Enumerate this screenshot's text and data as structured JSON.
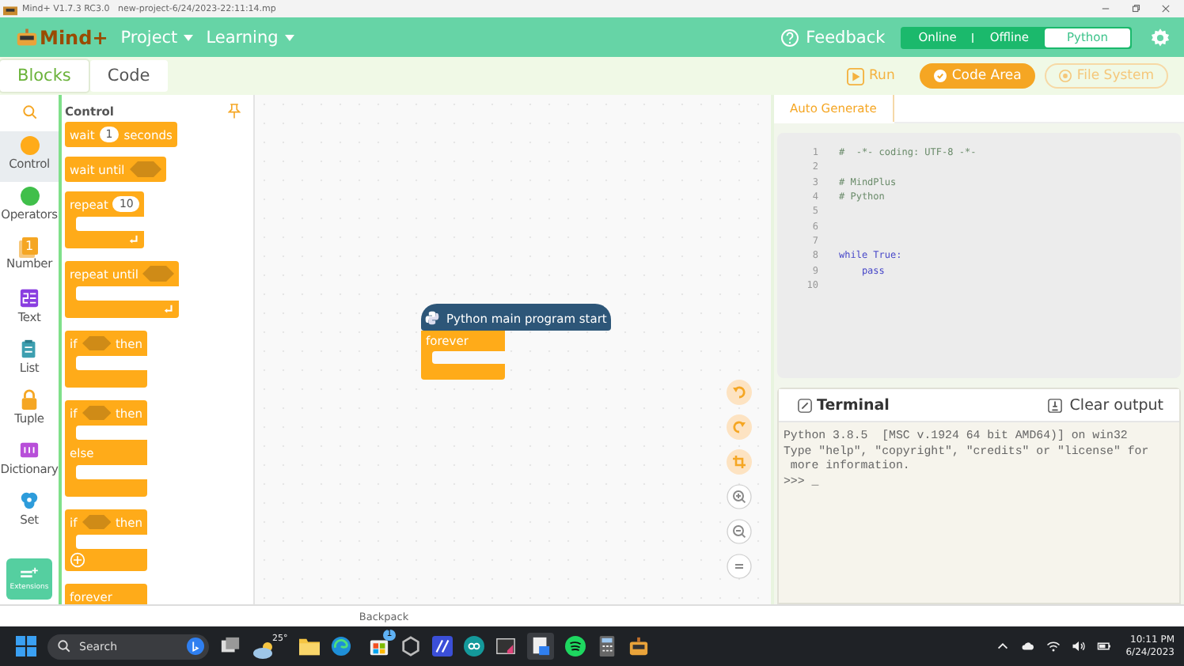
{
  "window": {
    "title": "Mind+ V1.7.3 RC3.0   new-project-6/24/2023-22:11:14.mp"
  },
  "header": {
    "logo": "Mind+",
    "menus": [
      {
        "label": "Project"
      },
      {
        "label": "Learning"
      }
    ],
    "feedback": "Feedback",
    "modes": [
      {
        "label": "Online",
        "selected": false
      },
      {
        "label": "Offline",
        "selected": false
      },
      {
        "label": "Python",
        "selected": true
      }
    ]
  },
  "toolbar": {
    "tabs": [
      {
        "label": "Blocks",
        "selected": true
      },
      {
        "label": "Code",
        "selected": false
      }
    ],
    "actions": [
      {
        "label": "Run",
        "kind": "run",
        "selected": false
      },
      {
        "label": "Code Area",
        "kind": "pill",
        "selected": true
      },
      {
        "label": "File System",
        "kind": "pill",
        "selected": false
      }
    ]
  },
  "categories": [
    {
      "label": "Control",
      "kind": "dot",
      "color": "#ffab19",
      "selected": true
    },
    {
      "label": "Operators",
      "kind": "dot",
      "color": "#40bf4a",
      "selected": false
    },
    {
      "label": "Number",
      "kind": "number",
      "glyph": "1",
      "selected": false
    },
    {
      "label": "Text",
      "kind": "text",
      "selected": false
    },
    {
      "label": "List",
      "kind": "list",
      "selected": false
    },
    {
      "label": "Tuple",
      "kind": "tuple",
      "selected": false
    },
    {
      "label": "Dictionary",
      "kind": "dictionary",
      "selected": false
    },
    {
      "label": "Set",
      "kind": "set",
      "selected": false
    }
  ],
  "extensions": "Extensions",
  "palette": {
    "title": "Control",
    "blocks": [
      {
        "kind": "stack",
        "parts": [
          {
            "kind": "label",
            "text": "wait"
          },
          {
            "kind": "number",
            "text": "1"
          },
          {
            "kind": "label",
            "text": "seconds"
          }
        ]
      },
      {
        "kind": "stack",
        "parts": [
          {
            "kind": "label",
            "text": "wait until"
          },
          {
            "kind": "slot"
          }
        ]
      },
      {
        "kind": "loop",
        "parts": [
          {
            "kind": "label",
            "text": "repeat"
          },
          {
            "kind": "number",
            "text": "10"
          }
        ]
      },
      {
        "kind": "loop",
        "parts": [
          {
            "kind": "label",
            "text": "repeat until"
          },
          {
            "kind": "slot"
          }
        ]
      },
      {
        "kind": "if",
        "parts": [
          {
            "kind": "label",
            "text": "if"
          },
          {
            "kind": "slot"
          },
          {
            "kind": "label",
            "text": "then"
          }
        ]
      },
      {
        "kind": "ifelse",
        "parts": [
          {
            "kind": "label",
            "text": "if"
          },
          {
            "kind": "slot"
          },
          {
            "kind": "label",
            "text": "then"
          }
        ],
        "else": "else"
      },
      {
        "kind": "ifplus",
        "parts": [
          {
            "kind": "label",
            "text": "if"
          },
          {
            "kind": "slot"
          },
          {
            "kind": "label",
            "text": "then"
          }
        ]
      },
      {
        "kind": "cap",
        "parts": [
          {
            "kind": "label",
            "text": "forever"
          }
        ]
      }
    ]
  },
  "canvas": {
    "hat": "Python main program start",
    "body": "forever"
  },
  "code": {
    "tab": "Auto Generate",
    "lines": [
      {
        "num": "1",
        "text": "#  -*- coding: UTF-8 -*-",
        "kind": "comment"
      },
      {
        "num": "2",
        "kind": "blank"
      },
      {
        "num": "3",
        "text": "# MindPlus",
        "kind": "comment"
      },
      {
        "num": "4",
        "text": "# Python",
        "kind": "comment"
      },
      {
        "num": "5",
        "kind": "blank"
      },
      {
        "num": "6",
        "kind": "blank"
      },
      {
        "num": "7",
        "kind": "blank"
      },
      {
        "num": "8",
        "text": "while True:",
        "kind": "keyword"
      },
      {
        "num": "9",
        "text": "    pass",
        "kind": "keyword"
      },
      {
        "num": "10",
        "kind": "blank"
      }
    ]
  },
  "terminal": {
    "title": "Terminal",
    "clear": "Clear output",
    "output": [
      "Python 3.8.5  [MSC v.1924 64 bit AMD64)] on win32",
      "Type \"help\", \"copyright\", \"credits\" or \"license\" for",
      " more information.",
      ">>> _"
    ]
  },
  "backpack": "Backpack",
  "taskbar": {
    "search": "Search",
    "weather": "25°",
    "badge": "1",
    "time": "10:11 PM",
    "date": "6/24/2023"
  }
}
